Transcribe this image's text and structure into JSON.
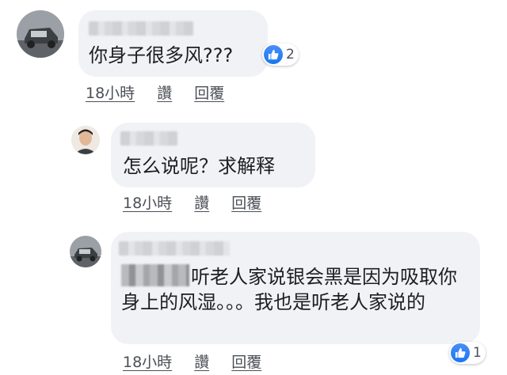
{
  "comments": [
    {
      "text": "你身子很多风???",
      "reaction_count": "2",
      "time": "18小時",
      "like_label": "讚",
      "reply_label": "回覆"
    },
    {
      "text": "怎么说呢？求解释",
      "time": "18小時",
      "like_label": "讚",
      "reply_label": "回覆"
    },
    {
      "text": "听老人家说银会黑是因为吸取你身上的风湿。。。我也是听老人家说的",
      "reaction_count": "1",
      "time": "18小時",
      "like_label": "讚",
      "reply_label": "回覆"
    }
  ],
  "colors": {
    "bubble": "#f0f2f5",
    "like_blue": "#1877f2",
    "meta_text": "#4b4f56"
  }
}
